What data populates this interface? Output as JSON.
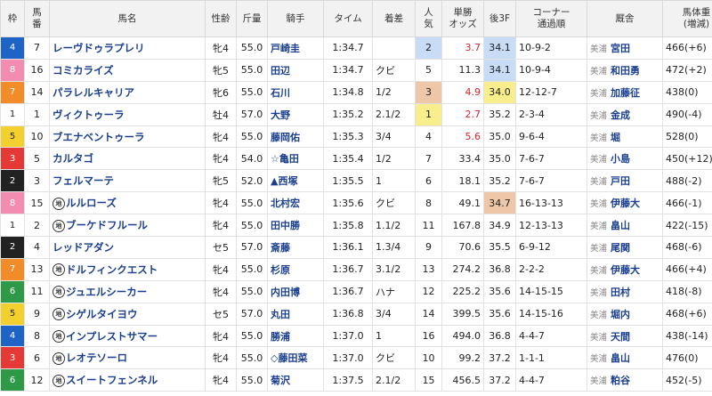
{
  "headers": {
    "waku": "枠",
    "umaban": "馬\n番",
    "name": "馬名",
    "sex_age": "性齢",
    "weight": "斤量",
    "jockey": "騎手",
    "time": "タイム",
    "margin": "着差",
    "pop": "人\n気",
    "odds": "単勝\nオッズ",
    "last3f": "後3F",
    "corner": "コーナー\n通過順",
    "trainer": "厩舎",
    "body_weight": "馬体重\n(増減)"
  },
  "waku_colors": {
    "1": {
      "bg": "#ffffff",
      "fg": "#222"
    },
    "2": {
      "bg": "#222222",
      "fg": "#fff"
    },
    "3": {
      "bg": "#e53935",
      "fg": "#fff"
    },
    "4": {
      "bg": "#1e63c6",
      "fg": "#fff"
    },
    "5": {
      "bg": "#f2d12e",
      "fg": "#222"
    },
    "6": {
      "bg": "#2e9a48",
      "fg": "#fff"
    },
    "7": {
      "bg": "#f28c28",
      "fg": "#fff"
    },
    "8": {
      "bg": "#f28cb1",
      "fg": "#fff"
    }
  },
  "rows": [
    {
      "waku": "4",
      "umaban": "7",
      "marker": "",
      "name": "レーヴドゥラプレリ",
      "sex_age": "牝4",
      "weight": "55.0",
      "jockey": "戸崎圭",
      "time": "1:34.7",
      "margin": "",
      "pop": "2",
      "pop_bg": "#c9dcf5",
      "odds": "3.7",
      "odds_red": true,
      "last3f": "34.1",
      "last3f_bg": "#c9dcf5",
      "corner": "10-9-2",
      "trainer_loc": "美浦",
      "trainer": "宮田",
      "body_weight": "466(+6)"
    },
    {
      "waku": "8",
      "umaban": "16",
      "marker": "",
      "name": "コミカライズ",
      "sex_age": "牝5",
      "weight": "55.0",
      "jockey": "田辺",
      "time": "1:34.7",
      "margin": "クビ",
      "pop": "5",
      "pop_bg": "",
      "odds": "11.3",
      "odds_red": false,
      "last3f": "34.1",
      "last3f_bg": "#c9dcf5",
      "corner": "10-9-4",
      "trainer_loc": "美浦",
      "trainer": "和田勇",
      "body_weight": "472(+2)"
    },
    {
      "waku": "7",
      "umaban": "14",
      "marker": "",
      "name": "パラレルキャリア",
      "sex_age": "牝6",
      "weight": "55.0",
      "jockey": "石川",
      "time": "1:34.8",
      "margin": "1/2",
      "pop": "3",
      "pop_bg": "#edc7a7",
      "odds": "4.9",
      "odds_red": true,
      "last3f": "34.0",
      "last3f_bg": "#f8ef8c",
      "corner": "12-12-7",
      "trainer_loc": "美浦",
      "trainer": "加藤征",
      "body_weight": "438(0)"
    },
    {
      "waku": "1",
      "umaban": "1",
      "marker": "",
      "name": "ヴィクトゥーラ",
      "sex_age": "牡4",
      "weight": "57.0",
      "jockey": "大野",
      "time": "1:35.2",
      "margin": "2.1/2",
      "pop": "1",
      "pop_bg": "#f8ef8c",
      "odds": "2.7",
      "odds_red": true,
      "last3f": "35.2",
      "last3f_bg": "",
      "corner": "2-3-4",
      "trainer_loc": "美浦",
      "trainer": "金成",
      "body_weight": "490(-4)"
    },
    {
      "waku": "5",
      "umaban": "10",
      "marker": "",
      "name": "ブエナベントゥーラ",
      "sex_age": "牝4",
      "weight": "55.0",
      "jockey": "藤岡佑",
      "time": "1:35.3",
      "margin": "3/4",
      "pop": "4",
      "pop_bg": "",
      "odds": "5.6",
      "odds_red": true,
      "last3f": "35.0",
      "last3f_bg": "",
      "corner": "9-6-4",
      "trainer_loc": "美浦",
      "trainer": "堀",
      "body_weight": "528(0)"
    },
    {
      "waku": "3",
      "umaban": "5",
      "marker": "",
      "name": "カルタゴ",
      "sex_age": "牝4",
      "weight": "54.0",
      "jockey": "☆亀田",
      "time": "1:35.4",
      "margin": "1/2",
      "pop": "7",
      "pop_bg": "",
      "odds": "33.4",
      "odds_red": false,
      "last3f": "35.0",
      "last3f_bg": "",
      "corner": "7-6-7",
      "trainer_loc": "美浦",
      "trainer": "小島",
      "body_weight": "450(+12)"
    },
    {
      "waku": "2",
      "umaban": "3",
      "marker": "",
      "name": "フェルマーテ",
      "sex_age": "牝5",
      "weight": "52.0",
      "jockey": "▲西塚",
      "time": "1:35.5",
      "margin": "1",
      "pop": "6",
      "pop_bg": "",
      "odds": "18.1",
      "odds_red": false,
      "last3f": "35.2",
      "last3f_bg": "",
      "corner": "7-6-7",
      "trainer_loc": "美浦",
      "trainer": "戸田",
      "body_weight": "488(-2)"
    },
    {
      "waku": "8",
      "umaban": "15",
      "marker": "地",
      "name": "ルルローズ",
      "sex_age": "牝4",
      "weight": "55.0",
      "jockey": "北村宏",
      "time": "1:35.6",
      "margin": "クビ",
      "pop": "8",
      "pop_bg": "",
      "odds": "49.1",
      "odds_red": false,
      "last3f": "34.7",
      "last3f_bg": "#edc7a7",
      "corner": "16-13-13",
      "trainer_loc": "美浦",
      "trainer": "伊藤大",
      "body_weight": "466(-1)"
    },
    {
      "waku": "1",
      "umaban": "2",
      "marker": "地",
      "name": "ブーケドフルール",
      "sex_age": "牝4",
      "weight": "55.0",
      "jockey": "田中勝",
      "time": "1:35.8",
      "margin": "1.1/2",
      "pop": "11",
      "pop_bg": "",
      "odds": "167.8",
      "odds_red": false,
      "last3f": "34.9",
      "last3f_bg": "",
      "corner": "12-13-13",
      "trainer_loc": "美浦",
      "trainer": "畠山",
      "body_weight": "422(-15)"
    },
    {
      "waku": "2",
      "umaban": "4",
      "marker": "",
      "name": "レッドアダン",
      "sex_age": "セ5",
      "weight": "57.0",
      "jockey": "斎藤",
      "time": "1:36.1",
      "margin": "1.3/4",
      "pop": "9",
      "pop_bg": "",
      "odds": "70.6",
      "odds_red": false,
      "last3f": "35.5",
      "last3f_bg": "",
      "corner": "6-9-12",
      "trainer_loc": "美浦",
      "trainer": "尾関",
      "body_weight": "468(-6)"
    },
    {
      "waku": "7",
      "umaban": "13",
      "marker": "地",
      "name": "ドルフィンクエスト",
      "sex_age": "牝4",
      "weight": "55.0",
      "jockey": "杉原",
      "time": "1:36.7",
      "margin": "3.1/2",
      "pop": "13",
      "pop_bg": "",
      "odds": "274.2",
      "odds_red": false,
      "last3f": "36.8",
      "last3f_bg": "",
      "corner": "2-2-2",
      "trainer_loc": "美浦",
      "trainer": "伊藤大",
      "body_weight": "466(+4)"
    },
    {
      "waku": "6",
      "umaban": "11",
      "marker": "地",
      "name": "ジュエルシーカー",
      "sex_age": "牝4",
      "weight": "55.0",
      "jockey": "内田博",
      "time": "1:36.7",
      "margin": "ハナ",
      "pop": "12",
      "pop_bg": "",
      "odds": "225.2",
      "odds_red": false,
      "last3f": "35.6",
      "last3f_bg": "",
      "corner": "14-15-15",
      "trainer_loc": "美浦",
      "trainer": "田村",
      "body_weight": "418(-8)"
    },
    {
      "waku": "5",
      "umaban": "9",
      "marker": "地",
      "name": "シゲルタイヨウ",
      "sex_age": "セ5",
      "weight": "57.0",
      "jockey": "丸田",
      "time": "1:36.8",
      "margin": "3/4",
      "pop": "14",
      "pop_bg": "",
      "odds": "399.5",
      "odds_red": false,
      "last3f": "35.6",
      "last3f_bg": "",
      "corner": "14-15-16",
      "trainer_loc": "美浦",
      "trainer": "堀内",
      "body_weight": "468(+6)"
    },
    {
      "waku": "4",
      "umaban": "8",
      "marker": "地",
      "name": "インプレストサマー",
      "sex_age": "牝4",
      "weight": "55.0",
      "jockey": "勝浦",
      "time": "1:37.0",
      "margin": "1",
      "pop": "16",
      "pop_bg": "",
      "odds": "494.0",
      "odds_red": false,
      "last3f": "36.8",
      "last3f_bg": "",
      "corner": "4-4-7",
      "trainer_loc": "美浦",
      "trainer": "天間",
      "body_weight": "438(-14)"
    },
    {
      "waku": "3",
      "umaban": "6",
      "marker": "地",
      "name": "レオテソーロ",
      "sex_age": "牝4",
      "weight": "55.0",
      "jockey": "◇藤田菜",
      "time": "1:37.0",
      "margin": "クビ",
      "pop": "10",
      "pop_bg": "",
      "odds": "99.2",
      "odds_red": false,
      "last3f": "37.2",
      "last3f_bg": "",
      "corner": "1-1-1",
      "trainer_loc": "美浦",
      "trainer": "畠山",
      "body_weight": "476(0)"
    },
    {
      "waku": "6",
      "umaban": "12",
      "marker": "地",
      "name": "スイートフェンネル",
      "sex_age": "牝4",
      "weight": "55.0",
      "jockey": "菊沢",
      "time": "1:37.5",
      "margin": "2.1/2",
      "pop": "15",
      "pop_bg": "",
      "odds": "456.5",
      "odds_red": false,
      "last3f": "37.2",
      "last3f_bg": "",
      "corner": "4-4-7",
      "trainer_loc": "美浦",
      "trainer": "粕谷",
      "body_weight": "452(-5)"
    }
  ]
}
